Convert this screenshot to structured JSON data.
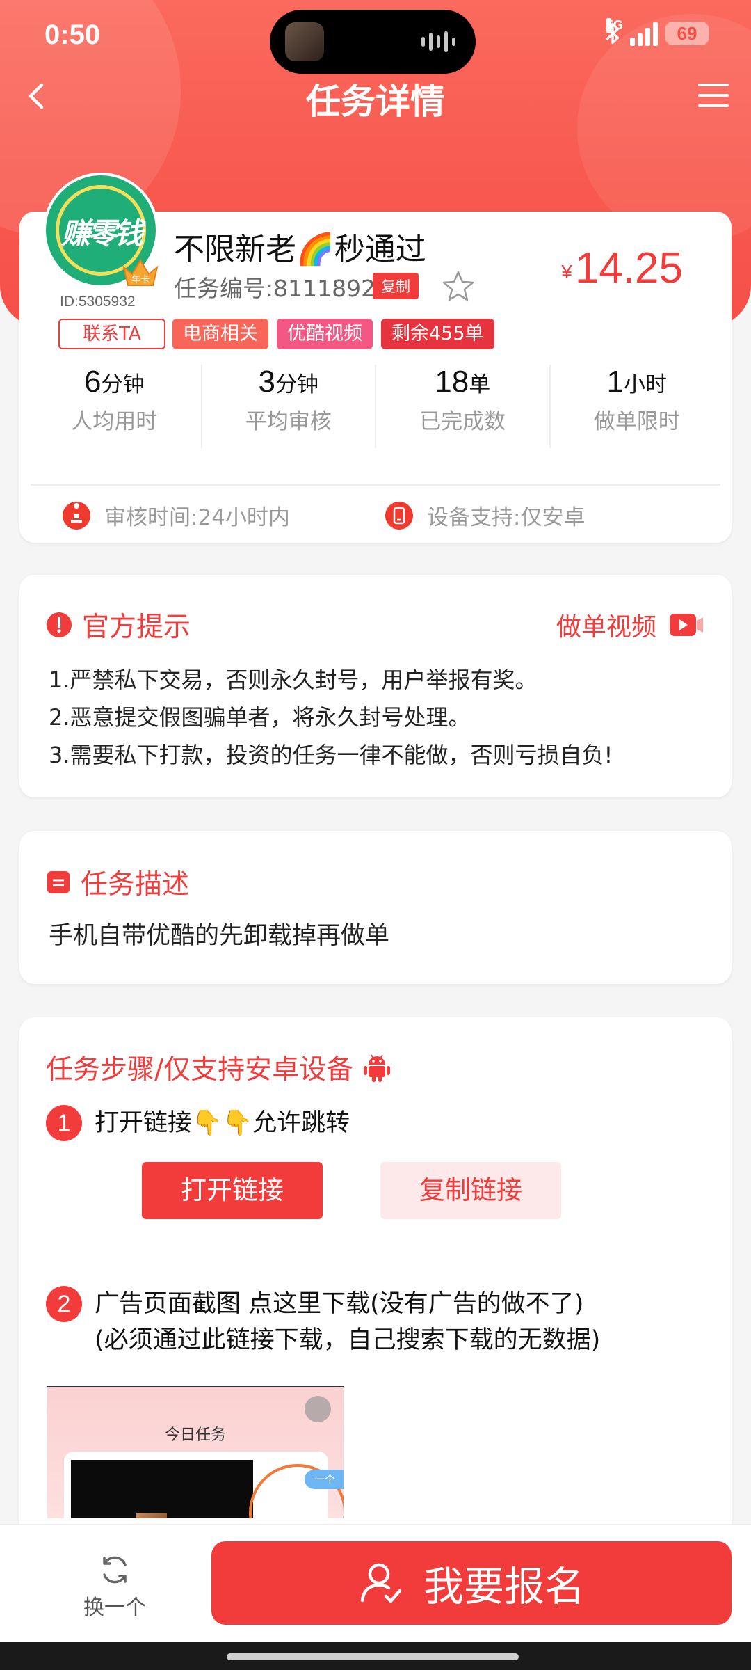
{
  "status_bar": {
    "time": "0:50",
    "network": "5G",
    "battery": "69",
    "battery_level_pct": 69
  },
  "header": {
    "title": "任务详情"
  },
  "task": {
    "avatar_text": "赚零钱",
    "avatar_badge": "年卡",
    "user_id": "ID:5305932",
    "contact_label": "联系TA",
    "title": "不限新老🌈秒通过",
    "number": "任务编号:8111892",
    "copy_label": "复制",
    "price_currency": "¥",
    "price": "14.25",
    "tags": [
      "电商相关",
      "优酷视频",
      "剩余455单"
    ],
    "stats": [
      {
        "value": "6",
        "unit": "分钟",
        "label": "人均用时"
      },
      {
        "value": "3",
        "unit": "分钟",
        "label": "平均审核"
      },
      {
        "value": "18",
        "unit": "单",
        "label": "已完成数"
      },
      {
        "value": "1",
        "unit": "小时",
        "label": "做单限时"
      }
    ],
    "review_time": "审核时间:24小时内",
    "device_support": "设备支持:仅安卓"
  },
  "notice": {
    "title": "官方提示",
    "video_link": "做单视频",
    "items": [
      "1.严禁私下交易，否则永久封号，用户举报有奖。",
      "2.恶意提交假图骗单者，将永久封号处理。",
      "3.需要私下打款，投资的任务一律不能做，否则亏损自负!"
    ]
  },
  "description": {
    "title": "任务描述",
    "text": "手机自带优酷的先卸载掉再做单"
  },
  "steps": {
    "title": "任务步骤/仅支持安卓设备",
    "step1": {
      "num": "1",
      "text": "打开链接👇👇允许跳转",
      "open_label": "打开链接",
      "copy_label": "复制链接"
    },
    "step2": {
      "num": "2",
      "line1": "广告页面截图  点这里下载(没有广告的做不了)",
      "line2": "(必须通过此链接下载，自己搜索下载的无数据)"
    },
    "preview_title": "今日任务",
    "preview_tag": "一个"
  },
  "bottom": {
    "switch_label": "换一个",
    "signup_label": "我要报名"
  },
  "colors": {
    "accent": "#f23b3b",
    "header": "#f8584d"
  }
}
